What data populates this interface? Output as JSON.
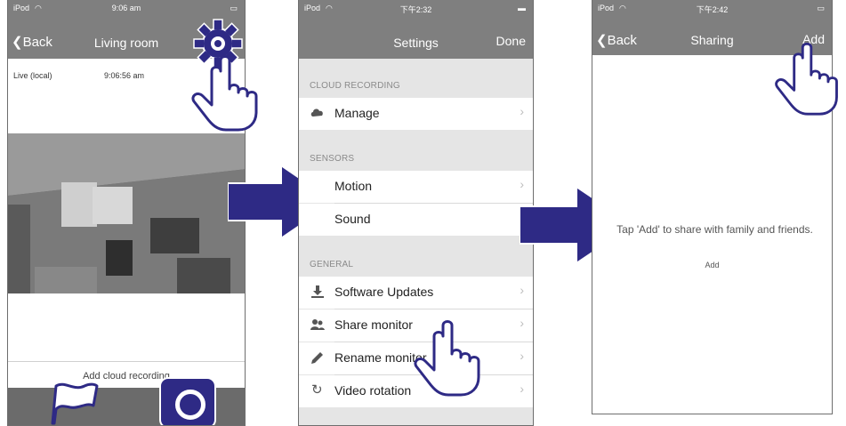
{
  "phone1": {
    "status": {
      "carrier": "iPod",
      "time": "9:06 am"
    },
    "nav": {
      "back_label": "Back",
      "title": "Living room"
    },
    "feed": {
      "mode_label": "Live (local)",
      "timestamp": "9:06:56 am"
    },
    "cloud_label": "Add cloud recording"
  },
  "phone2": {
    "status": {
      "carrier": "iPod",
      "time": "下午2:32"
    },
    "nav": {
      "title": "Settings",
      "done_label": "Done"
    },
    "sections": {
      "cloud": "CLOUD RECORDING",
      "sensors": "SENSORS",
      "general": "GENERAL"
    },
    "rows": {
      "manage": "Manage",
      "motion": "Motion",
      "sound": "Sound",
      "software_updates": "Software Updates",
      "share_monitor": "Share monitor",
      "rename_monitor": "Rename monitor",
      "video_rotation": "Video rotation"
    },
    "chevron": "›"
  },
  "phone3": {
    "status": {
      "carrier": "iPod",
      "time": "下午2:42"
    },
    "nav": {
      "back_label": "Back",
      "title": "Sharing",
      "add_label": "Add"
    },
    "empty_message": "Tap 'Add' to share with family and friends.",
    "add_link": "Add"
  },
  "colors": {
    "arrow": "#2e2a85",
    "navbar": "#7f7f7f",
    "section_bg": "#e5e5e5",
    "toolbar": "#6b6b6b"
  },
  "icons": [
    "gear-icon",
    "hand-pointer-icon",
    "flag-icon",
    "camera-icon",
    "cloud-icon",
    "download-icon",
    "users-icon",
    "pencil-icon",
    "rotate-icon",
    "chevron-left-icon"
  ]
}
